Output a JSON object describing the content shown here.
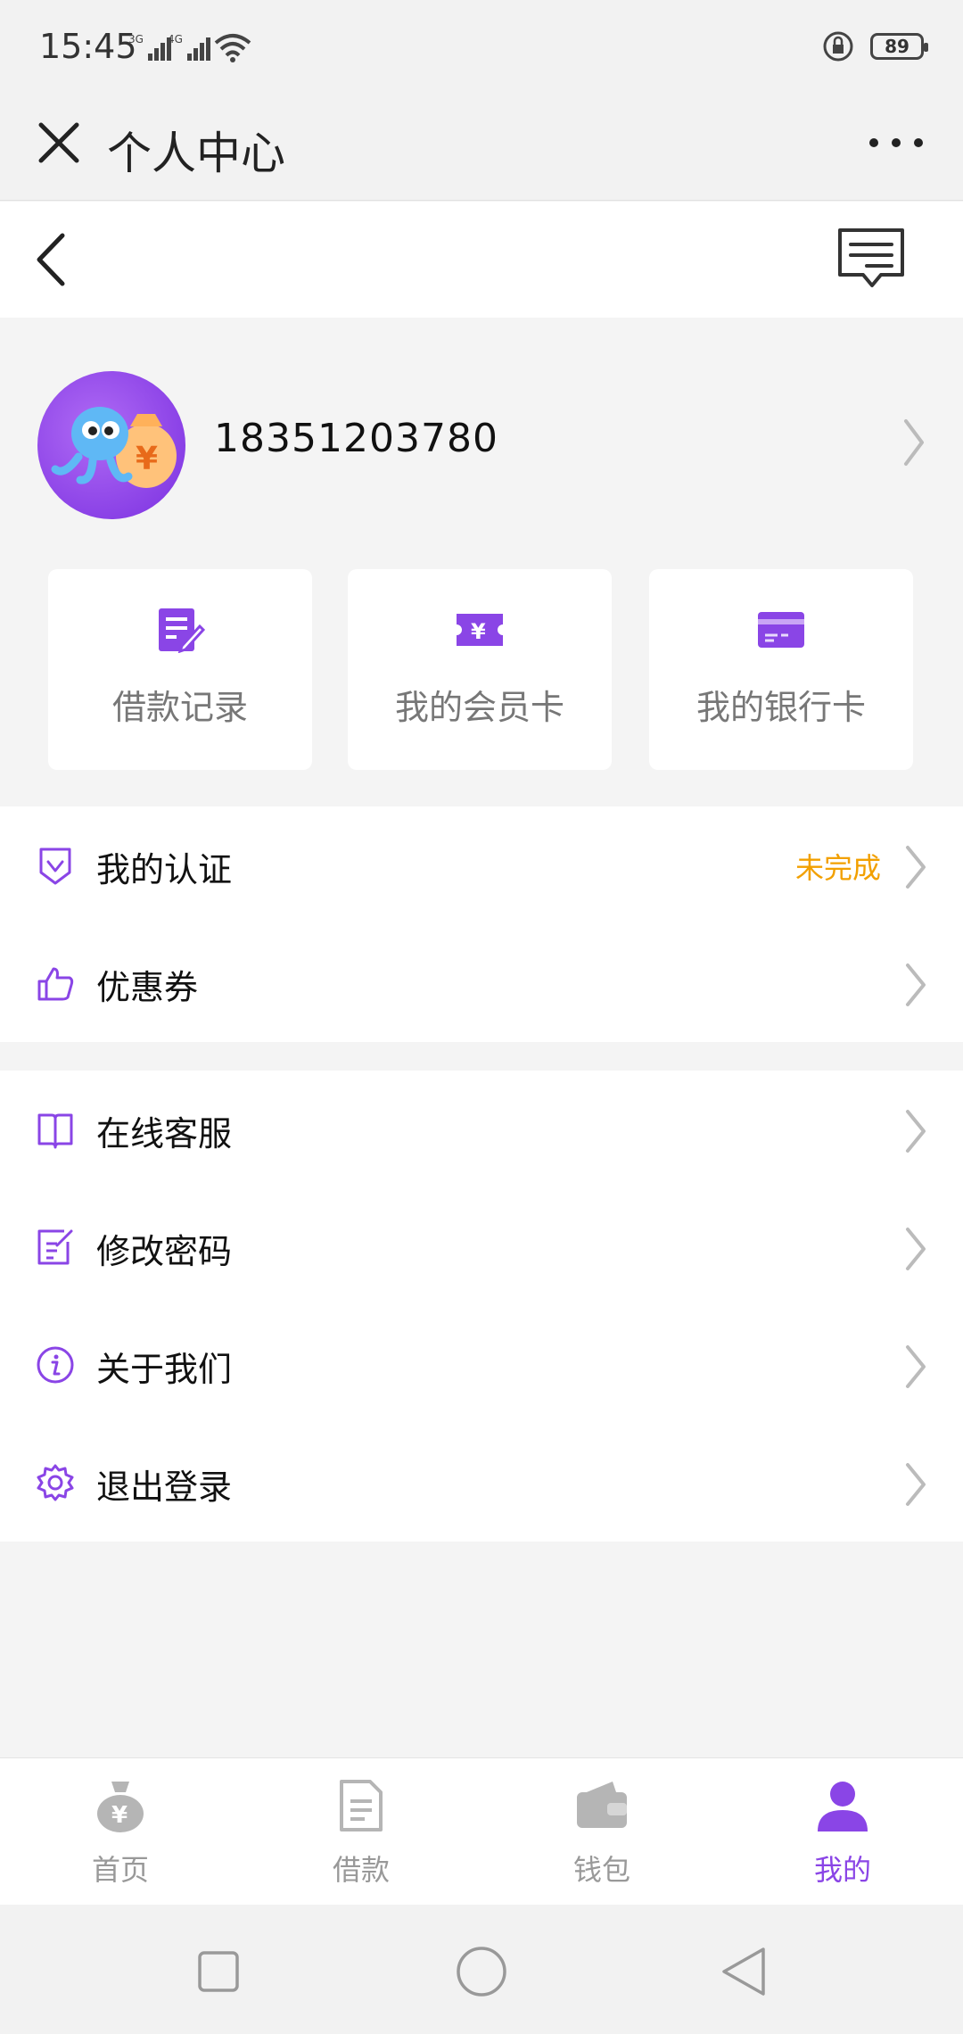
{
  "status_bar": {
    "time": "15:45",
    "signal_1_label": "3G",
    "signal_2_label": "4G",
    "battery": "89"
  },
  "title_bar": {
    "title": "个人中心"
  },
  "profile": {
    "phone": "18351203780"
  },
  "quick_cards": [
    {
      "label": "借款记录",
      "icon": "document-edit-icon"
    },
    {
      "label": "我的会员卡",
      "icon": "ticket-yen-icon"
    },
    {
      "label": "我的银行卡",
      "icon": "bank-card-icon"
    }
  ],
  "menu_group_1": [
    {
      "label": "我的认证",
      "status": "未完成",
      "icon": "shield-check-icon"
    },
    {
      "label": "优惠券",
      "icon": "thumbs-up-icon"
    }
  ],
  "menu_group_2": [
    {
      "label": "在线客服",
      "icon": "book-icon"
    },
    {
      "label": "修改密码",
      "icon": "edit-note-icon"
    },
    {
      "label": "关于我们",
      "icon": "info-icon"
    },
    {
      "label": "退出登录",
      "icon": "gear-icon"
    }
  ],
  "tabbar": [
    {
      "label": "首页",
      "icon": "money-bag-icon"
    },
    {
      "label": "借款",
      "icon": "document-icon"
    },
    {
      "label": "钱包",
      "icon": "wallet-icon"
    },
    {
      "label": "我的",
      "icon": "user-icon",
      "active": true
    }
  ],
  "colors": {
    "accent": "#8a45e6",
    "warning": "#f2a000",
    "background": "#f4f4f4"
  }
}
